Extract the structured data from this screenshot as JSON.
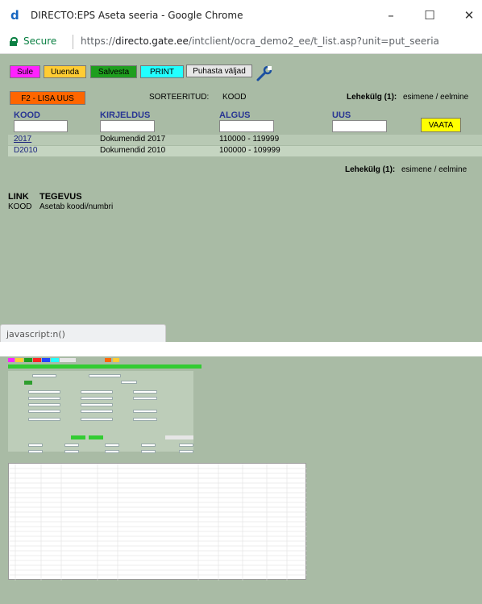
{
  "window": {
    "title": "DIRECTO:EPS Aseta seeria - Google Chrome",
    "logo": "d",
    "minimize": "–",
    "maximize": "☐",
    "close": "✕"
  },
  "address": {
    "secure": "Secure",
    "url_prefix": "https://",
    "url_host": "directo.gate.ee",
    "url_path": "/intclient/ocra_demo2_ee/t_list.asp?unit=put_seeria"
  },
  "toolbar": {
    "sule": "Sule",
    "uuenda": "Uuenda",
    "salvesta": "Salvesta",
    "print": "PRINT",
    "puhasta": "Puhasta väljad",
    "colors": {
      "sule": "#ff22ff",
      "uuenda": "#ffcc33",
      "salvesta": "#1e9e1e",
      "print": "#22ffff",
      "puhasta": "#e6e6e6"
    }
  },
  "actions": {
    "lisa_uus": "F2 - LISA UUS",
    "sorted_label": "SORTEERITUD:",
    "sorted_value": "KOOD",
    "page_label": "Lehekülg (1):",
    "page_nav": "esimene / eelmine",
    "vaata": "VAATA"
  },
  "table": {
    "columns": [
      "KOOD",
      "KIRJELDUS",
      "ALGUS",
      "UUS"
    ],
    "rows": [
      {
        "kood": "2017",
        "kirjeldus": "Dokumendid 2017",
        "algus": "110000 - 119999"
      },
      {
        "kood": "D2010",
        "kirjeldus": "Dokumendid 2010",
        "algus": "100000 - 109999"
      }
    ]
  },
  "legend": {
    "link_header": "LINK",
    "tegevus_header": "TEGEVUS",
    "row_link": "KOOD",
    "row_action": "Asetab koodi/numbri"
  },
  "status": {
    "text": "javascript:n()"
  }
}
